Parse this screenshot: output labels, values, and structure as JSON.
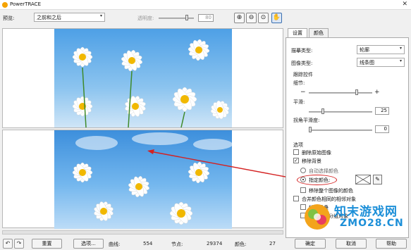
{
  "window": {
    "title": "PowerTRACE"
  },
  "toolbar": {
    "preview_label": "预览:",
    "preview_value": "之前和之后",
    "transparency_label": "透明度:",
    "transparency_value": "80"
  },
  "bottom": {
    "reset_label": "重置",
    "options_label": "选项...",
    "curves_label": "曲线:",
    "curves_value": "554",
    "nodes_label": "节点:",
    "nodes_value": "29374",
    "colors_label": "颜色:",
    "colors_value": "27",
    "ok_label": "确定",
    "cancel_label": "取消",
    "help_label": "帮助"
  },
  "right_panel": {
    "tabs": [
      {
        "label": "设置"
      },
      {
        "label": "颜色"
      }
    ],
    "trace_type_label": "描摹类型:",
    "trace_type_value": "轮廓",
    "image_type_label": "图像类型:",
    "image_type_value": "线条图",
    "trace_controls_title": "跟踪控件",
    "detail_label": "细节:",
    "detail_minus": "−",
    "detail_plus": "+",
    "smoothing_label": "平滑:",
    "smoothing_value": "25",
    "corner_label": "拐角平滑度:",
    "corner_value": "0",
    "options_title": "选项",
    "delete_original_label": "删除原始图像",
    "remove_background_label": "移除背景",
    "auto_color_label": "自动选择颜色",
    "specify_color_label": "指定颜色:",
    "remove_entire_label": "移除整个图像的颜色",
    "merge_label": "合并颜色相同的相邻对象",
    "remove_overlap_label": "移除重叠",
    "group_label": "根据颜色分组对象"
  },
  "watermark": {
    "line1": "知末游戏网",
    "line2": "ZMO28.CN"
  }
}
